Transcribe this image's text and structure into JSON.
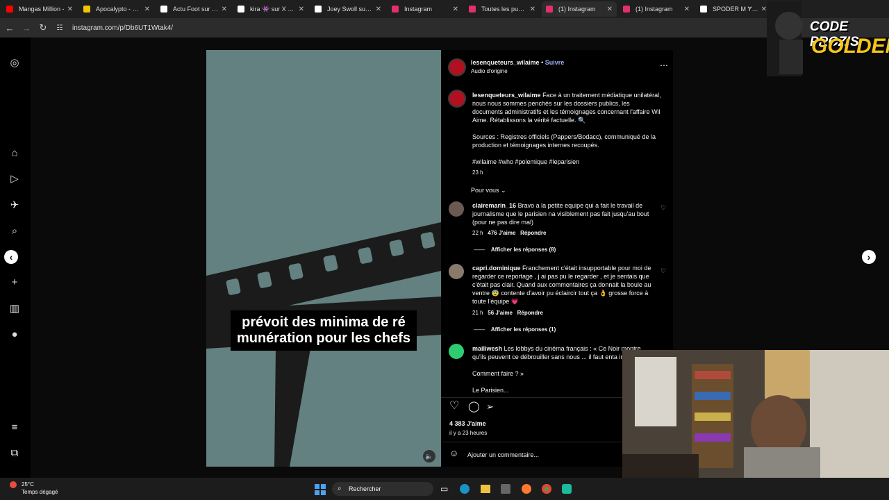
{
  "tabs": [
    {
      "label": "Mangas Million -",
      "icon": "youtube-icon",
      "color": "#ff0000"
    },
    {
      "label": "Apocalypto - Film",
      "icon": "bookmark-icon",
      "color": "#f2c500"
    },
    {
      "label": "Actu Foot sur X :",
      "icon": "x-icon",
      "color": "#ffffff"
    },
    {
      "label": "kira 👾 sur X : \"w",
      "icon": "x-icon",
      "color": "#ffffff"
    },
    {
      "label": "Joey Swoll sur X :",
      "icon": "x-icon",
      "color": "#ffffff"
    },
    {
      "label": "Instagram",
      "icon": "instagram-icon",
      "color": "#e1306c"
    },
    {
      "label": "Toutes les publica",
      "icon": "instagram-icon",
      "color": "#e1306c"
    },
    {
      "label": "(1) Instagram",
      "icon": "instagram-icon",
      "color": "#e1306c",
      "active": true
    },
    {
      "label": "(1) Instagram",
      "icon": "instagram-icon",
      "color": "#e1306c"
    },
    {
      "label": "SPODER M Ɏ N s",
      "icon": "x-icon",
      "color": "#ffffff"
    }
  ],
  "address": {
    "url": "instagram.com/p/Db6UT1Wtak4/"
  },
  "reel": {
    "caption": "prévoit des minima de ré munération pour les chefs"
  },
  "post": {
    "username": "lesenqueteurs_wilaime",
    "follow": "Suivre",
    "audio": "Audio d'origine",
    "caption_user": "lesenqueteurs_wilaime",
    "caption_text": "Face à un traitement médiatique unilatéral, nous nous sommes penchés sur les dossiers publics, les documents administratifs et les témoignages concernant l'affaire Wil Aime. Rétablissons la vérité factuelle. 🔍",
    "sources": "Sources : Registres officiels (Pappers/Bodacc), communiqué de la production et témoignages internes recoupés.",
    "hashtags": "#wilaime #who #polemique #leparisien",
    "time": "23 h",
    "sort": "Pour vous"
  },
  "comments": [
    {
      "user": "clairemarin_16",
      "text": "Bravo a la petite equipe qui a fait le travail de journalisme que le parisien na visiblement pas fait jusqu'au bout (pour ne pas dire mal)",
      "time": "22 h",
      "likes": "476 J'aime",
      "reply": "Répondre",
      "replies": "Afficher les réponses (8)"
    },
    {
      "user": "capri.dominique",
      "text": "Franchement c'était insupportable pour moi de regarder ce reportage , j ai pas pu le regarder , et je sentais que c'était pas clair. Quand aux commentaires ça donnait la boule au ventre 😨 contente d'avoir pu éclaircir tout ça 👌 grosse force à toute l'équipe 💗",
      "time": "21 h",
      "likes": "56 J'aime",
      "reply": "Répondre",
      "replies": "Afficher les réponses (1)"
    },
    {
      "user": "mailiwesh",
      "text": "Les lobbys du cinéma français : « Ce Noir montre qu'ils peuvent ce débrouiller sans nous ... il faut enta image)",
      "extra1": "Comment faire ? »",
      "extra2": "Le Parisien..."
    }
  ],
  "footer": {
    "likes": "4 383 J'aime",
    "ago": "il y a 23 heures",
    "comment_placeholder": "Ajouter un commentaire..."
  },
  "taskbar": {
    "temp": "25°C",
    "weather": "Temps dégagé",
    "search": "Rechercher"
  },
  "logo": {
    "line1": "CODE PROZIS",
    "line2": "GOLDENG"
  }
}
